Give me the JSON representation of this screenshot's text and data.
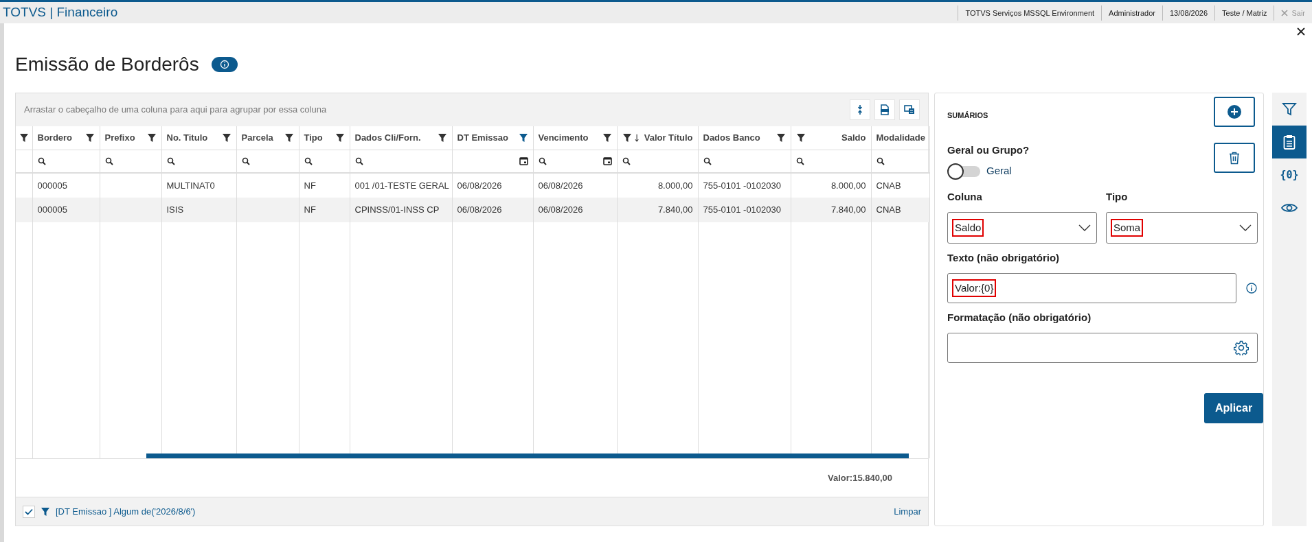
{
  "app": {
    "title": "TOTVS | Financeiro",
    "status_items": [
      "TOTVS Serviços MSSQL Environment",
      "Administrador",
      "13/08/2026",
      "Teste / Matriz"
    ],
    "logout": {
      "label": "Sair",
      "disabled": true
    }
  },
  "page": {
    "title": "Emissão de Borderôs"
  },
  "grid": {
    "group_hint": "Arrastar o cabeçalho de uma coluna para aqui para agrupar por essa coluna",
    "columns": [
      {
        "label": "Bordero",
        "kind": "text",
        "filter_active": false
      },
      {
        "label": "Prefixo",
        "kind": "text",
        "filter_active": false
      },
      {
        "label": "No. Titulo",
        "kind": "text",
        "filter_active": false
      },
      {
        "label": "Parcela",
        "kind": "text",
        "filter_active": false
      },
      {
        "label": "Tipo",
        "kind": "text",
        "filter_active": false
      },
      {
        "label": "Dados Cli/Forn.",
        "kind": "text",
        "filter_active": false
      },
      {
        "label": "DT Emissao",
        "kind": "date",
        "filter_active": true
      },
      {
        "label": "Vencimento",
        "kind": "datesearch",
        "filter_active": false
      },
      {
        "label": "Valor Título",
        "kind": "number",
        "filter_active": false,
        "sorted": true
      },
      {
        "label": "Dados Banco",
        "kind": "text",
        "filter_active": false
      },
      {
        "label": "Saldo",
        "kind": "number",
        "filter_active": false
      },
      {
        "label": "Modalidade",
        "kind": "plain"
      }
    ],
    "rows": [
      {
        "cells": [
          "000005",
          null,
          "MULTINAT0",
          null,
          "NF",
          "001 /01-TESTE GERAL",
          "06/08/2026",
          "06/08/2026",
          "8.000,00",
          "755-0101 -0102030",
          "8.000,00",
          "CNAB"
        ]
      },
      {
        "cells": [
          "000005",
          null,
          "ISIS",
          null,
          "NF",
          "CPINSS/01-INSS CP",
          "06/08/2026",
          "06/08/2026",
          "7.840,00",
          "755-0101 -0102030",
          "7.840,00",
          "CNAB"
        ]
      }
    ],
    "summary": "Valor:15.840,00",
    "filter_bar": {
      "enabled": true,
      "text": "[DT Emissao ] Algum de('2026/8/6')",
      "clear": "Limpar"
    }
  },
  "summaries": {
    "title": "SUMÁRIOS",
    "scope_label": "Geral ou Grupo?",
    "toggle": {
      "on": false,
      "label": "Geral"
    },
    "column": {
      "label": "Coluna",
      "value": "Saldo",
      "highlighted": true
    },
    "type": {
      "label": "Tipo",
      "value": "Soma",
      "highlighted": true
    },
    "text": {
      "label": "Texto (não obrigatório)",
      "value": "Valor:{0}",
      "highlighted": true
    },
    "format": {
      "label": "Formatação (não obrigatório)"
    },
    "apply": "Aplicar"
  },
  "rail": [
    {
      "kind": "filter",
      "selected": false
    },
    {
      "kind": "clipboard",
      "selected": true
    },
    {
      "kind": "braces",
      "glyph": "{0}",
      "selected": false
    },
    {
      "kind": "eye",
      "selected": false
    }
  ]
}
